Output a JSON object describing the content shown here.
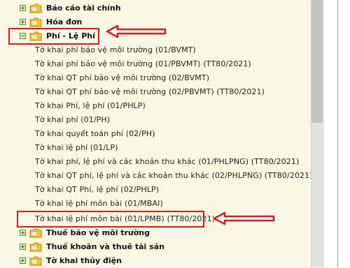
{
  "tree": {
    "folders_top": [
      {
        "label": "Báo cáo tài chính"
      },
      {
        "label": "Hóa đơn"
      },
      {
        "label": "Phí - Lệ Phí"
      }
    ],
    "items": [
      "Tờ khai phí bảo vệ môi trường (01/BVMT)",
      "Tờ khai phí bảo vệ môi trường (01/PBVMT) (TT80/2021)",
      "Tờ khai QT phí bảo vệ môi trường (02/BVMT)",
      "Tờ khai QT phí bảo vệ môi trường (02/PBVMT) (TT80/2021)",
      "Tờ khai Phí, lệ phí (01/PHLP)",
      "Tờ khai phí (01/PH)",
      "Tờ khai quyết toán phí (02/PH)",
      "Tờ khai lệ phí (01/LP)",
      "Tờ khai phí, lệ phí và các khoản thu khác (01/PHLPNG) (TT80/2021)",
      "Tờ khai QT phí, lệ phí và các khoản thu khác (02/PHLPNG) (TT80/2021)",
      "Tờ khai QT Phí, lệ phí (02/PHLP)",
      "Tờ khai lệ phí môn bài (01/MBAI)",
      "Tờ khai lệ phí môn bài (01/LPMB) (TT80/2021)"
    ],
    "folders_bottom": [
      {
        "label": "Thuế bảo vệ môi trường"
      },
      {
        "label": "Thuế khoản và thuê tài sản"
      },
      {
        "label": "Tờ khai thủy điện"
      }
    ]
  },
  "colors": {
    "highlight": "#e01919",
    "folder": "#f2c23e",
    "background": "#faf8e4"
  }
}
